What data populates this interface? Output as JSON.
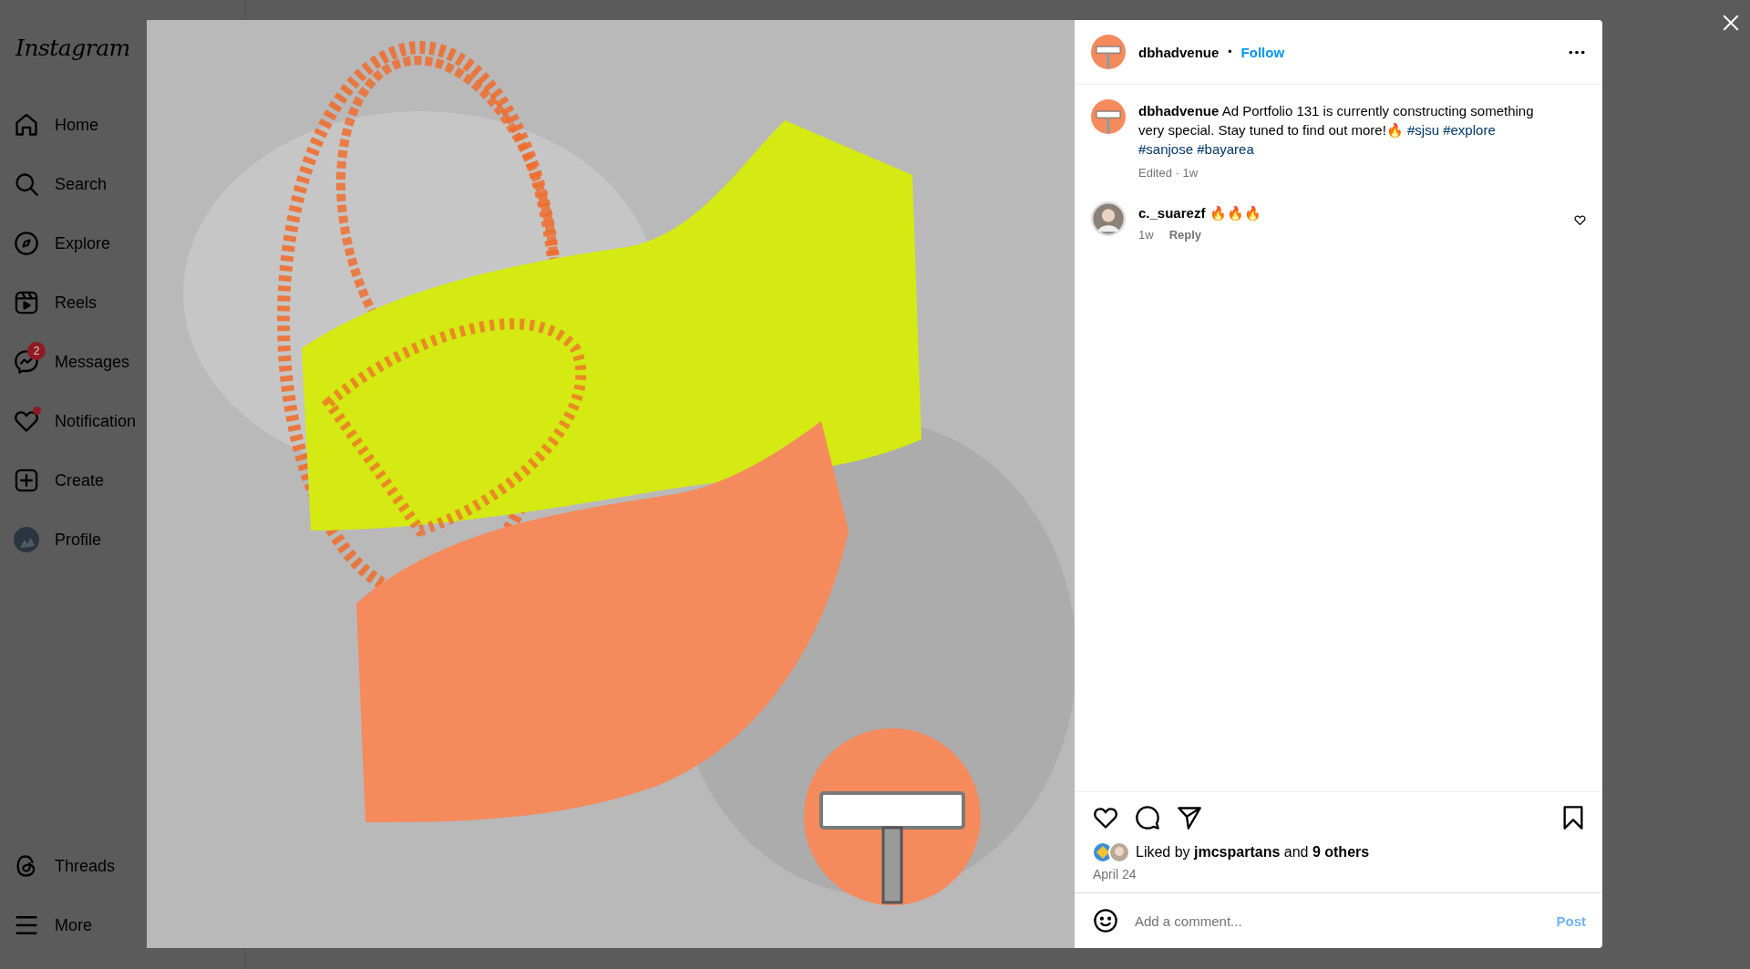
{
  "sidebar": {
    "logo": "Instagram",
    "items": [
      {
        "label": "Home",
        "dot": false
      },
      {
        "label": "Search",
        "dot": false
      },
      {
        "label": "Explore",
        "dot": false
      },
      {
        "label": "Reels",
        "dot": false
      },
      {
        "label": "Messages",
        "dot": false,
        "badge": "2"
      },
      {
        "label": "Notification",
        "dot": true
      },
      {
        "label": "Create",
        "dot": false
      },
      {
        "label": "Profile",
        "dot": false
      }
    ],
    "bottom_items": [
      {
        "label": "Threads"
      },
      {
        "label": "More"
      }
    ]
  },
  "post": {
    "header": {
      "username": "dbhadvenue",
      "separator": "•",
      "follow": "Follow"
    },
    "caption": {
      "username": "dbhadvenue",
      "text": "Ad Portfolio 131 is currently constructing something very special. Stay tuned to find out more!🔥",
      "hashtags": [
        "#sjsu",
        "#explore",
        "#sanjose",
        "#bayarea"
      ],
      "meta": "Edited · 1w"
    },
    "comments": [
      {
        "username": "c._suarezf",
        "text": "🔥🔥🔥",
        "time": "1w",
        "reply": "Reply",
        "liked": false
      }
    ],
    "likes": "Liked by **jmcspartans** and **9 others**",
    "date": "April 24",
    "saved": false,
    "comment_box": {
      "placeholder": "Add a comment...",
      "post": "Post"
    }
  }
}
